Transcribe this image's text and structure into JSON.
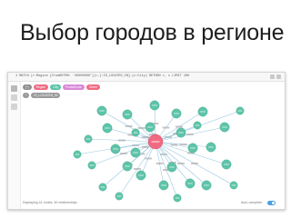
{
  "slide": {
    "title": "Выбор городов в регионе"
  },
  "window": {
    "query": "1  MATCH (r:Region {fromOKTMO: '45000000'})<-[:IS_LOCATED_IN]-(c:City) RETURN r, c LIMIT 100",
    "sidebar_tabs": [
      "database-icon",
      "star-icon",
      "info-icon"
    ],
    "legend": {
      "labels": [
        {
          "label": "(*)",
          "color": "#8f8f8f"
        },
        {
          "label": "Region",
          "color": "#f06a82"
        },
        {
          "label": "City",
          "color": "#5ec4a9"
        },
        {
          "label": "PostalCode",
          "color": "#d988d6"
        },
        {
          "label": "Street",
          "color": "#f06a82"
        }
      ],
      "relationships": [
        {
          "label": "*",
          "color": "#9a9a9a"
        },
        {
          "label": "IS_LOCATED_IN",
          "color": "#9a9a9a"
        }
      ]
    },
    "status": "Displaying 41 nodes, 40 relationships.",
    "autocomplete_label": "Auto-complete",
    "colors": {
      "hub": "#f06a82",
      "city": "#5ec4a9",
      "edge": "#9cc8e2",
      "edge_label": "#9a9a9a"
    }
  }
}
